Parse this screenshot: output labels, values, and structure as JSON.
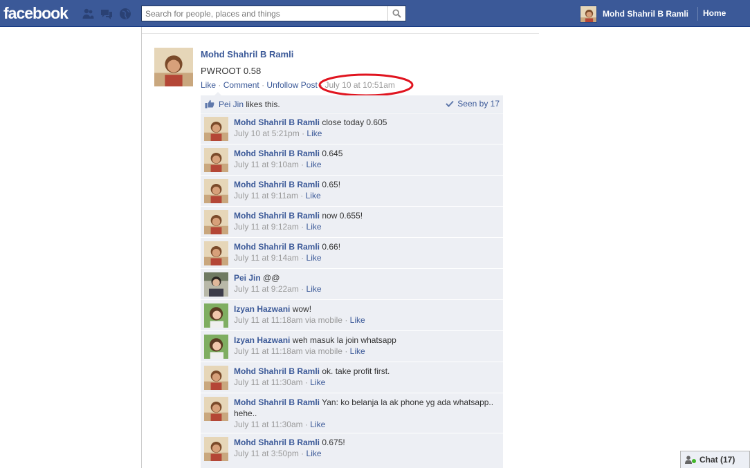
{
  "topbar": {
    "logo": "facebook",
    "search_placeholder": "Search for people, places and things",
    "user_name": "Mohd Shahril B Ramli",
    "home_label": "Home"
  },
  "post": {
    "author": "Mohd Shahril B Ramli",
    "text": "PWROOT 0.58",
    "actions": {
      "like": "Like",
      "comment": "Comment",
      "unfollow": "Unfollow Post",
      "sep": "·"
    },
    "timestamp": "July 10 at 10:51am",
    "highlight_color": "#e0141f"
  },
  "ufi": {
    "likes_name": "Pei Jin",
    "likes_suffix": "likes this.",
    "seen_label": "Seen by 17"
  },
  "comments": [
    {
      "author": "Mohd Shahril B Ramli",
      "text": "close today 0.605",
      "time": "July 10 at 5:21pm",
      "like": "Like",
      "avatar": "shahril"
    },
    {
      "author": "Mohd Shahril B Ramli",
      "text": "0.645",
      "time": "July 11 at 9:10am",
      "like": "Like",
      "avatar": "shahril"
    },
    {
      "author": "Mohd Shahril B Ramli",
      "text": "0.65!",
      "time": "July 11 at 9:11am",
      "like": "Like",
      "avatar": "shahril"
    },
    {
      "author": "Mohd Shahril B Ramli",
      "text": "now 0.655!",
      "time": "July 11 at 9:12am",
      "like": "Like",
      "avatar": "shahril"
    },
    {
      "author": "Mohd Shahril B Ramli",
      "text": "0.66!",
      "time": "July 11 at 9:14am",
      "like": "Like",
      "avatar": "shahril"
    },
    {
      "author": "Pei Jin",
      "text": "@@",
      "time": "July 11 at 9:22am",
      "like": "Like",
      "avatar": "peijin"
    },
    {
      "author": "Izyan Hazwani",
      "text": "wow!",
      "time": "July 11 at 11:18am via mobile",
      "like": "Like",
      "avatar": "izyan"
    },
    {
      "author": "Izyan Hazwani",
      "text": "weh masuk la join whatsapp",
      "time": "July 11 at 11:18am via mobile",
      "like": "Like",
      "avatar": "izyan"
    },
    {
      "author": "Mohd Shahril B Ramli",
      "text": "ok. take profit first.",
      "time": "July 11 at 11:30am",
      "like": "Like",
      "avatar": "shahril"
    },
    {
      "author": "Mohd Shahril B Ramli",
      "text": "Yan: ko belanja la ak phone yg ada whatsapp.. hehe..",
      "time": "July 11 at 11:30am",
      "like": "Like",
      "avatar": "shahril"
    },
    {
      "author": "Mohd Shahril B Ramli",
      "text": "0.675!",
      "time": "July 11 at 3:50pm",
      "like": "Like",
      "avatar": "shahril"
    }
  ],
  "chat": {
    "label": "Chat (17)"
  },
  "colors": {
    "brand": "#3b5998",
    "comment_bg": "#edeff4",
    "online": "#42b72a"
  }
}
